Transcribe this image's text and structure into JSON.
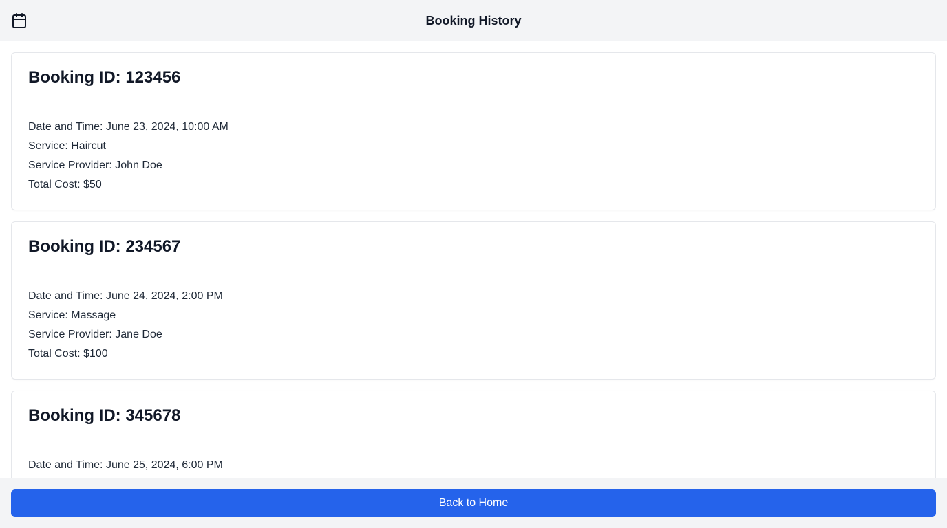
{
  "header": {
    "title": "Booking History",
    "icon": "calendar-icon"
  },
  "bookings": [
    {
      "id_label": "Booking ID: 123456",
      "datetime": "Date and Time: June 23, 2024, 10:00 AM",
      "service": "Service: Haircut",
      "provider": "Service Provider: John Doe",
      "cost": "Total Cost: $50"
    },
    {
      "id_label": "Booking ID: 234567",
      "datetime": "Date and Time: June 24, 2024, 2:00 PM",
      "service": "Service: Massage",
      "provider": "Service Provider: Jane Doe",
      "cost": "Total Cost: $100"
    },
    {
      "id_label": "Booking ID: 345678",
      "datetime": "Date and Time: June 25, 2024, 6:00 PM",
      "service": "",
      "provider": "",
      "cost": ""
    }
  ],
  "footer": {
    "button_label": "Back to Home",
    "button_color": "#2563eb"
  },
  "colors": {
    "header_bg": "#f3f4f6",
    "card_border": "#e5e7eb",
    "accent": "#2563eb"
  }
}
